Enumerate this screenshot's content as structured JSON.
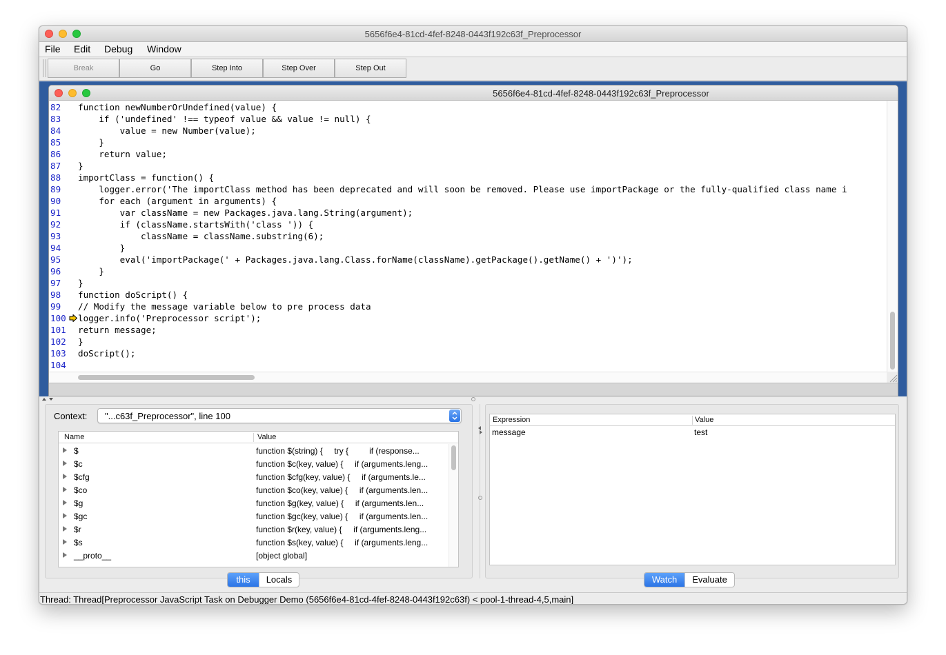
{
  "window": {
    "title": "5656f6e4-81cd-4fef-8248-0443f192c63f_Preprocessor"
  },
  "menu": {
    "items": [
      "File",
      "Edit",
      "Debug",
      "Window"
    ]
  },
  "toolbar": {
    "buttons": [
      "Break",
      "Go",
      "Step Into",
      "Step Over",
      "Step Out"
    ]
  },
  "script_window": {
    "title": "5656f6e4-81cd-4fef-8248-0443f192c63f_Preprocessor",
    "current_line": 100,
    "lines": [
      {
        "n": "82",
        "code": "function newNumberOrUndefined(value) {"
      },
      {
        "n": "83",
        "code": "    if ('undefined' !== typeof value && value != null) {"
      },
      {
        "n": "84",
        "code": "        value = new Number(value);"
      },
      {
        "n": "85",
        "code": "    }"
      },
      {
        "n": "86",
        "code": "    return value;"
      },
      {
        "n": "87",
        "code": "}"
      },
      {
        "n": "88",
        "code": "importClass = function() {"
      },
      {
        "n": "89",
        "code": "    logger.error('The importClass method has been deprecated and will soon be removed. Please use importPackage or the fully-qualified class name i"
      },
      {
        "n": "90",
        "code": "    for each (argument in arguments) {"
      },
      {
        "n": "91",
        "code": "        var className = new Packages.java.lang.String(argument);"
      },
      {
        "n": "92",
        "code": "        if (className.startsWith('class ')) {"
      },
      {
        "n": "93",
        "code": "            className = className.substring(6);"
      },
      {
        "n": "94",
        "code": "        }"
      },
      {
        "n": "95",
        "code": "        eval('importPackage(' + Packages.java.lang.Class.forName(className).getPackage().getName() + ')');"
      },
      {
        "n": "96",
        "code": "    }"
      },
      {
        "n": "97",
        "code": "}"
      },
      {
        "n": "98",
        "code": "function doScript() {"
      },
      {
        "n": "99",
        "code": "// Modify the message variable below to pre process data"
      },
      {
        "n": "100",
        "code": "logger.info('Preprocessor script');"
      },
      {
        "n": "101",
        "code": "return message;"
      },
      {
        "n": "102",
        "code": "}"
      },
      {
        "n": "103",
        "code": "doScript();"
      },
      {
        "n": "104",
        "code": ""
      }
    ]
  },
  "context": {
    "label": "Context:",
    "value": "\"...c63f_Preprocessor\", line 100"
  },
  "variables": {
    "columns": [
      "Name",
      "Value"
    ],
    "rows": [
      {
        "name": "$",
        "value": "function $(string) {     try {         if (response..."
      },
      {
        "name": "$c",
        "value": "function $c(key, value) {     if (arguments.leng..."
      },
      {
        "name": "$cfg",
        "value": "function $cfg(key, value) {     if (arguments.le..."
      },
      {
        "name": "$co",
        "value": "function $co(key, value) {     if (arguments.len..."
      },
      {
        "name": "$g",
        "value": "function $g(key, value) {     if (arguments.len..."
      },
      {
        "name": "$gc",
        "value": "function $gc(key, value) {     if (arguments.len..."
      },
      {
        "name": "$r",
        "value": "function $r(key, value) {     if (arguments.leng..."
      },
      {
        "name": "$s",
        "value": "function $s(key, value) {     if (arguments.leng..."
      },
      {
        "name": "__proto__",
        "value": "[object global]"
      }
    ],
    "tabs": [
      "this",
      "Locals"
    ],
    "active_tab": "this"
  },
  "watch": {
    "columns": [
      "Expression",
      "Value"
    ],
    "rows": [
      {
        "expression": "message",
        "value": "test"
      }
    ],
    "tabs": [
      "Watch",
      "Evaluate"
    ],
    "active_tab": "Watch"
  },
  "status": {
    "text": "Thread: Thread[Preprocessor JavaScript Task on Debugger Demo (5656f6e4-81cd-4fef-8248-0443f192c63f) < pool-1-thread-4,5,main]"
  },
  "colors": {
    "line_number": "#1a23c8",
    "desktop": "#2f5c9e",
    "accent": "#2b74e6",
    "exec_arrow": "#f5c400"
  }
}
